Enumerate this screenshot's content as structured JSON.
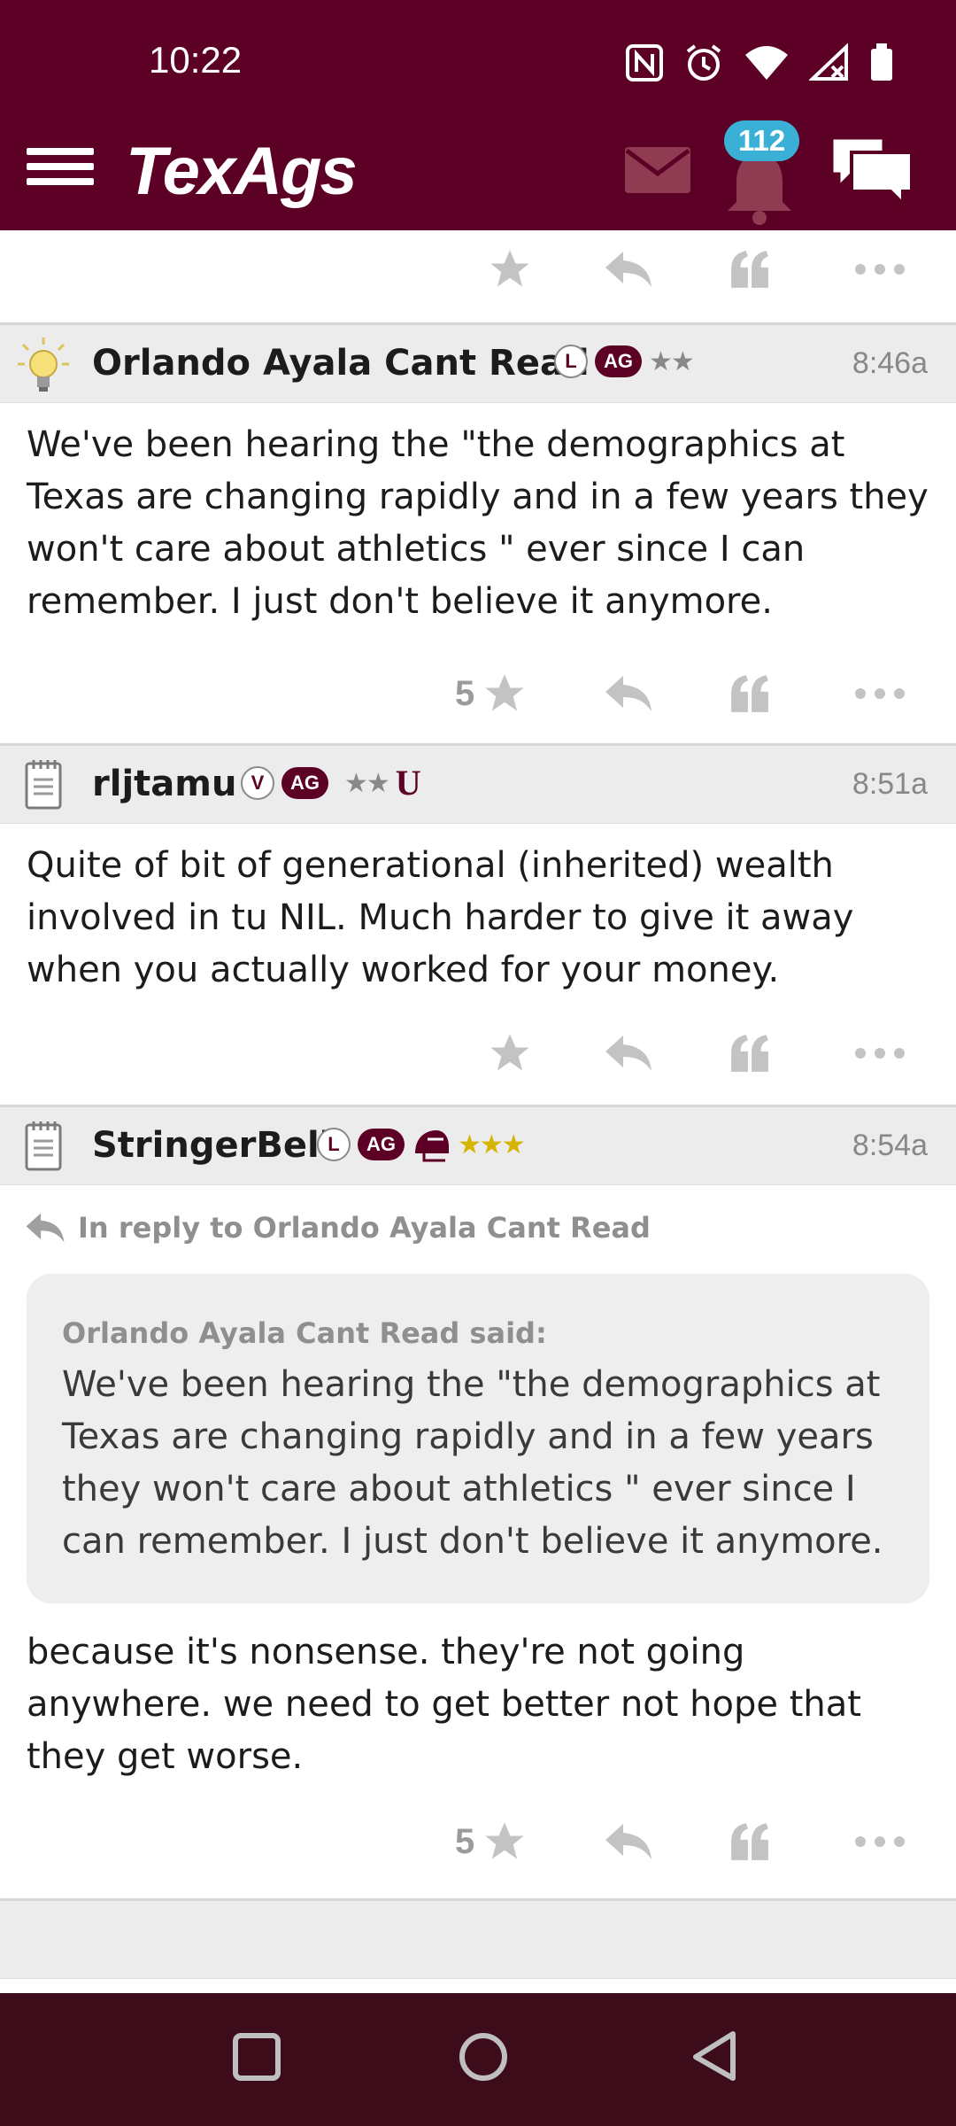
{
  "status": {
    "time": "10:22",
    "icons": [
      "nfc-icon",
      "alarm-icon",
      "wifi-icon",
      "signal-icon",
      "battery-icon"
    ]
  },
  "appbar": {
    "logo": "TexAgs",
    "notification_count": "112",
    "icons": [
      "hamburger-menu-icon",
      "mail-icon",
      "bell-icon",
      "chat-icon"
    ]
  },
  "colors": {
    "brand": "#5c0125",
    "badge": "#3ab0d6",
    "nav": "#3c0c1a",
    "gold_stars": "#d6b400"
  },
  "posts": [
    {
      "icon": "lightbulb-icon",
      "username": "Orlando Ayala Cant Read",
      "badge_letter": "L",
      "badge_ag": "AG",
      "stars": "★★",
      "time": "8:46a",
      "body": "We've been hearing the \"the demographics at Texas are changing rapidly and in a few years they won't care about athletics \" ever since I can remember. I just don't believe it anymore.",
      "star_count": "5"
    },
    {
      "icon": "notepad-icon",
      "username": "rljtamu",
      "badge_letter": "V",
      "badge_ag": "AG",
      "stars": "★★",
      "extra_badge": "U",
      "time": "8:51a",
      "body": "Quite of bit of generational (inherited) wealth involved in tu NIL. Much harder to give it away when you actually worked for your money."
    },
    {
      "icon": "notepad-icon",
      "username": "StringerBell",
      "badge_letter": "L",
      "badge_ag": "AG",
      "stars": "★★★",
      "time": "8:54a",
      "reply_to": "In reply to Orlando Ayala Cant Read",
      "quote_author": "Orlando Ayala Cant Read said:",
      "quote_text": "We've been hearing the \"the demographics at Texas are changing rapidly and in a few years they won't care about athletics \" ever since I can remember. I just don't believe it anymore.",
      "body": "because it's nonsense. they're not going anywhere. we need to get better not hope that they get worse.",
      "star_count": "5"
    }
  ],
  "navbar": {
    "icons": [
      "recents-icon",
      "home-icon",
      "back-icon"
    ]
  }
}
